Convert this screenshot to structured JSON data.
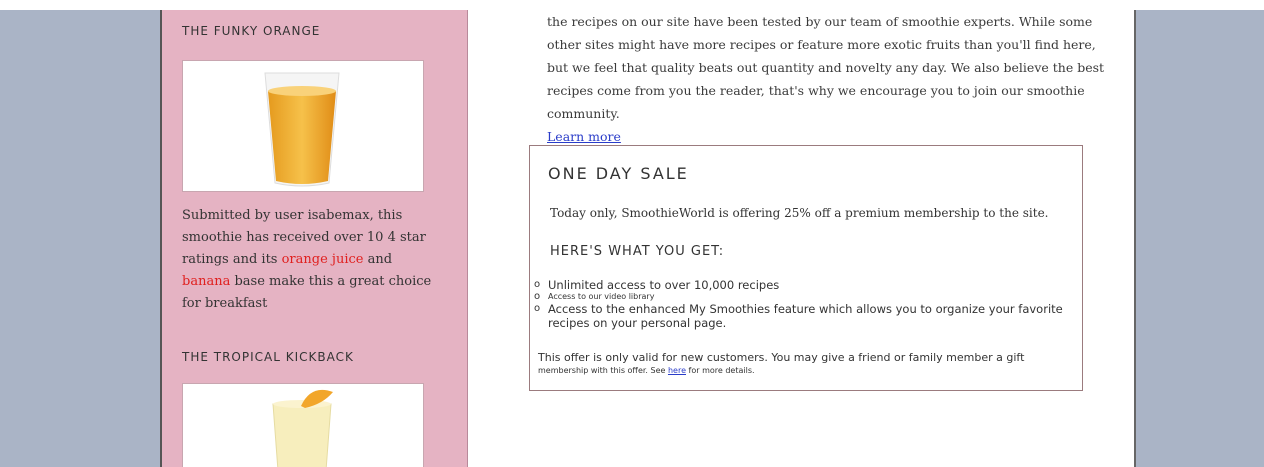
{
  "sidebar": {
    "item1_heading": "THE FUNKY ORANGE",
    "item1_desc_part1": "Submitted by user isabemax, this smoothie has received over 10 4 star ratings and its ",
    "item1_hl1": "orange juice",
    "item1_desc_part2": " and ",
    "item1_hl2": "banana",
    "item1_desc_part3": " base make this a great choice for breakfast",
    "item2_heading": "THE TROPICAL KICKBACK"
  },
  "main": {
    "intro": "the recipes on our site have been tested by our team of smoothie experts. While some other sites might have more recipes or feature more exotic fruits than you'll find here, but we feel that quality beats out quantity and novelty any day. We also believe the best recipes come from you the reader, that's why we encourage you to join our smoothie community.",
    "learn_more": "Learn more"
  },
  "sale": {
    "title": "ONE DAY SALE",
    "intro": "Today only, SmoothieWorld is offering 25% off a premium membership to the site.",
    "subheading": "HERE'S WHAT YOU GET:",
    "items": [
      "Unlimited access to over 10,000 recipes",
      "Access to our video library",
      "Access to the enhanced My Smoothies feature which allows you to organize your favorite recipes on your personal page."
    ],
    "note_line1": "This offer is only valid for new customers. You may give a friend or family member a gift",
    "note_line2_pre": "membership with this offer. See ",
    "note_link": "here",
    "note_line2_post": " for more details."
  },
  "colors": {
    "background": "#aab4c6",
    "sidebar": "#e5b3c3",
    "highlight": "#e0201f",
    "link": "#2a3cc9"
  }
}
